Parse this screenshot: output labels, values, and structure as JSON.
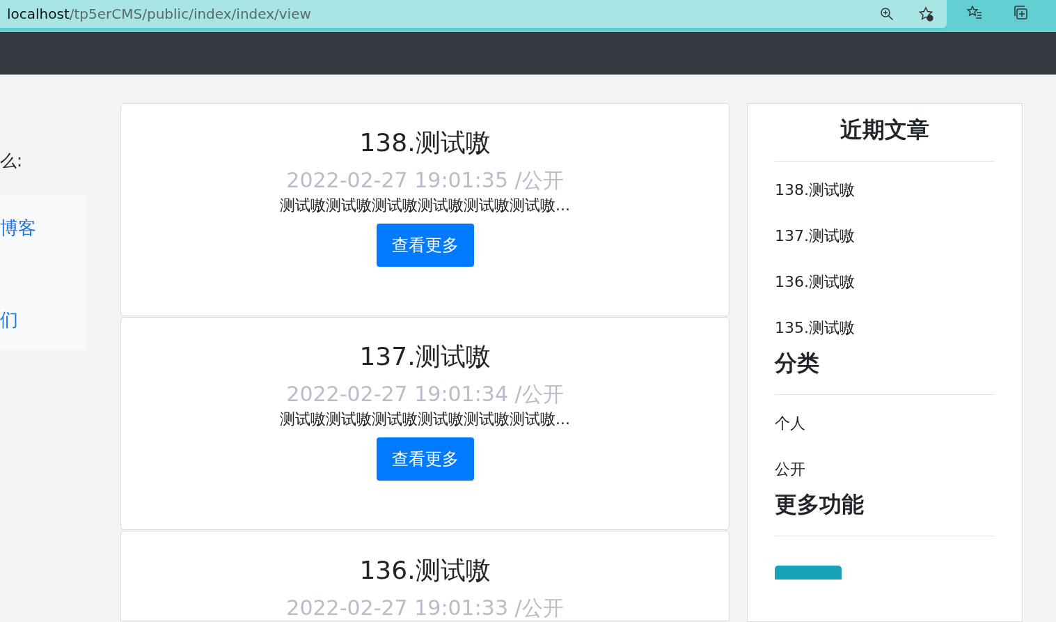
{
  "browser": {
    "url_host": "localhost",
    "url_path": "/tp5erCMS/public/index/index/view"
  },
  "left_panel": {
    "prompt": "么:",
    "links": [
      "博客",
      "们"
    ]
  },
  "posts": [
    {
      "title": "138.测试嗷",
      "date": "2022-02-27 19:01:35 /公开",
      "excerpt": "测试嗷测试嗷测试嗷测试嗷测试嗷测试嗷...",
      "button": "查看更多"
    },
    {
      "title": "137.测试嗷",
      "date": "2022-02-27 19:01:34 /公开",
      "excerpt": "测试嗷测试嗷测试嗷测试嗷测试嗷测试嗷...",
      "button": "查看更多"
    },
    {
      "title": "136.测试嗷",
      "date": "2022-02-27 19:01:33 /公开"
    }
  ],
  "sidebar": {
    "sections": [
      {
        "heading": "近期文章",
        "centered": true,
        "items": [
          "138.测试嗷",
          "137.测试嗷",
          "136.测试嗷",
          "135.测试嗷"
        ]
      },
      {
        "heading": "分类",
        "centered": false,
        "items": [
          "个人",
          "公开"
        ]
      },
      {
        "heading": "更多功能",
        "centered": false
      }
    ]
  }
}
